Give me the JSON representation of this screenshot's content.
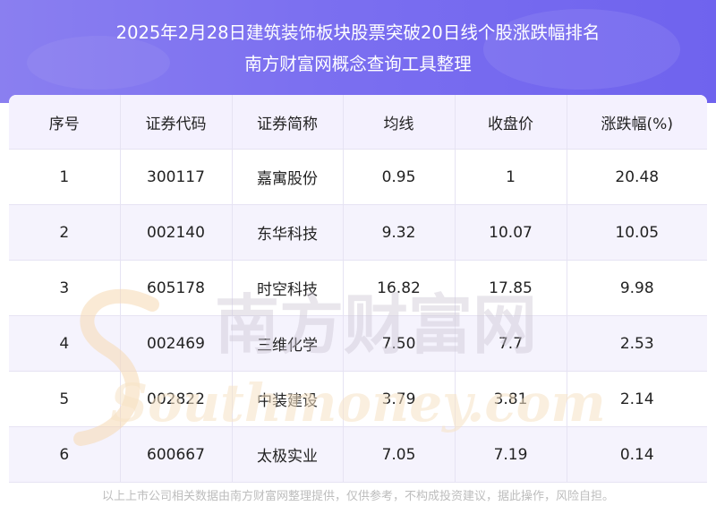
{
  "header": {
    "title_line1": "2025年2月28日建筑装饰板块股票突破20日线个股涨跌幅排名",
    "title_line2": "南方财富网概念查询工具整理"
  },
  "table": {
    "columns": [
      "序号",
      "证券代码",
      "证券简称",
      "均线",
      "收盘价",
      "涨跌幅(%)"
    ],
    "rows": [
      [
        "1",
        "300117",
        "嘉寓股份",
        "0.95",
        "1",
        "20.48"
      ],
      [
        "2",
        "002140",
        "东华科技",
        "9.32",
        "10.07",
        "10.05"
      ],
      [
        "3",
        "605178",
        "时空科技",
        "16.82",
        "17.85",
        "9.98"
      ],
      [
        "4",
        "002469",
        "三维化学",
        "7.50",
        "7.7",
        "2.53"
      ],
      [
        "5",
        "002822",
        "中装建设",
        "3.79",
        "3.81",
        "2.14"
      ],
      [
        "6",
        "600667",
        "太极实业",
        "7.05",
        "7.19",
        "0.14"
      ]
    ]
  },
  "watermark": {
    "cn": "南方财富网",
    "en": "Southmoney.com"
  },
  "footer": {
    "disclaimer": "以上上市公司相关数据由南方财富网整理提供，仅供参考，不构成投资建议，据此操作，风险自担。"
  },
  "colors": {
    "banner": "#7b6ff0",
    "header_row": "#f4f1fe",
    "stripe": "#f5f3fd"
  }
}
